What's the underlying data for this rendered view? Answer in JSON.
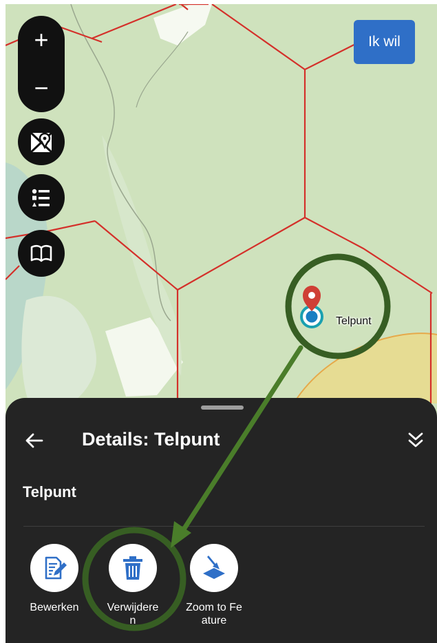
{
  "map": {
    "zoom_in_glyph": "+",
    "zoom_out_glyph": "−",
    "tool_icons": [
      "map-pin-icon",
      "legend-list-icon",
      "book-icon"
    ],
    "action_button_label": "Ik wil",
    "feature_marker_label": "Telpunt",
    "colors": {
      "map_green": "#cfe2bd",
      "grid_red": "#d4302a",
      "accent_blue": "#2f6fc7"
    }
  },
  "sheet": {
    "title": "Details: Telpunt",
    "feature_name": "Telpunt",
    "actions": [
      {
        "label": "Bewerken",
        "icon": "edit-document-icon"
      },
      {
        "label": "Verwijdere n",
        "icon": "trash-icon"
      },
      {
        "label": "Zoom to Feature",
        "icon": "zoom-to-feature-icon"
      }
    ]
  },
  "annotation": {
    "circle_color": "#375e23",
    "arrow_color": "#4a7d2a"
  }
}
